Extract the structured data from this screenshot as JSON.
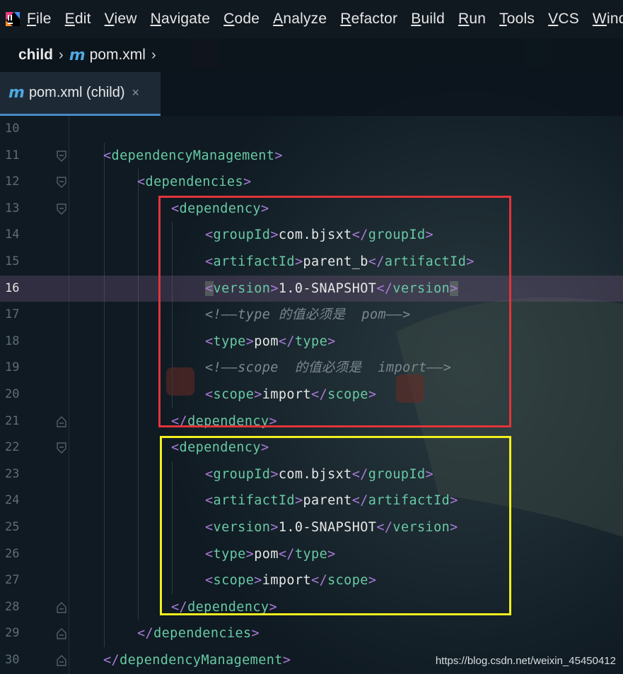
{
  "menu": {
    "items": [
      "File",
      "Edit",
      "View",
      "Navigate",
      "Code",
      "Analyze",
      "Refactor",
      "Build",
      "Run",
      "Tools",
      "VCS",
      "Windo"
    ]
  },
  "breadcrumb": {
    "project": "child",
    "file": "pom.xml"
  },
  "tab": {
    "label": "pom.xml (child)",
    "close": "×",
    "file_icon": "maven-m-icon"
  },
  "editor": {
    "current_line": "16",
    "lines": [
      {
        "num": "10",
        "tokens": []
      },
      {
        "num": "11",
        "tokens": [
          [
            "punct",
            "<"
          ],
          [
            "tag",
            "dependencyManagement"
          ],
          [
            "punct",
            ">"
          ]
        ]
      },
      {
        "num": "12",
        "tokens": [
          [
            "punct",
            "<"
          ],
          [
            "tag",
            "dependencies"
          ],
          [
            "punct",
            ">"
          ]
        ]
      },
      {
        "num": "13",
        "tokens": [
          [
            "punct",
            "<"
          ],
          [
            "tag",
            "dependency"
          ],
          [
            "punct",
            ">"
          ]
        ]
      },
      {
        "num": "14",
        "tokens": [
          [
            "punct",
            "<"
          ],
          [
            "tag",
            "groupId"
          ],
          [
            "punct",
            ">"
          ],
          [
            "text",
            "com.bjsxt"
          ],
          [
            "punct",
            "</"
          ],
          [
            "tag",
            "groupId"
          ],
          [
            "punct",
            ">"
          ]
        ]
      },
      {
        "num": "15",
        "tokens": [
          [
            "punct",
            "<"
          ],
          [
            "tag",
            "artifactId"
          ],
          [
            "punct",
            ">"
          ],
          [
            "text",
            "parent_b"
          ],
          [
            "punct",
            "</"
          ],
          [
            "tag",
            "artifactId"
          ],
          [
            "punct",
            ">"
          ]
        ]
      },
      {
        "num": "16",
        "tokens": [
          [
            "punct",
            "<"
          ],
          [
            "tag",
            "version"
          ],
          [
            "punct",
            ">"
          ],
          [
            "text",
            "1.0-SNAPSHOT"
          ],
          [
            "punct",
            "</"
          ],
          [
            "tag",
            "version"
          ],
          [
            "punct",
            ">"
          ]
        ]
      },
      {
        "num": "17",
        "tokens": [
          [
            "comment",
            "<!——type 的值必须是  pom——>"
          ]
        ]
      },
      {
        "num": "18",
        "tokens": [
          [
            "punct",
            "<"
          ],
          [
            "tag",
            "type"
          ],
          [
            "punct",
            ">"
          ],
          [
            "text",
            "pom"
          ],
          [
            "punct",
            "</"
          ],
          [
            "tag",
            "type"
          ],
          [
            "punct",
            ">"
          ]
        ]
      },
      {
        "num": "19",
        "tokens": [
          [
            "comment",
            "<!——scope  的值必须是  import——>"
          ]
        ]
      },
      {
        "num": "20",
        "tokens": [
          [
            "punct",
            "<"
          ],
          [
            "tag",
            "scope"
          ],
          [
            "punct",
            ">"
          ],
          [
            "text",
            "import"
          ],
          [
            "punct",
            "</"
          ],
          [
            "tag",
            "scope"
          ],
          [
            "punct",
            ">"
          ]
        ]
      },
      {
        "num": "21",
        "tokens": [
          [
            "punct",
            "</"
          ],
          [
            "tag",
            "dependency"
          ],
          [
            "punct",
            ">"
          ]
        ]
      },
      {
        "num": "22",
        "tokens": [
          [
            "punct",
            "<"
          ],
          [
            "tag",
            "dependency"
          ],
          [
            "punct",
            ">"
          ]
        ]
      },
      {
        "num": "23",
        "tokens": [
          [
            "punct",
            "<"
          ],
          [
            "tag",
            "groupId"
          ],
          [
            "punct",
            ">"
          ],
          [
            "text",
            "com.bjsxt"
          ],
          [
            "punct",
            "</"
          ],
          [
            "tag",
            "groupId"
          ],
          [
            "punct",
            ">"
          ]
        ]
      },
      {
        "num": "24",
        "tokens": [
          [
            "punct",
            "<"
          ],
          [
            "tag",
            "artifactId"
          ],
          [
            "punct",
            ">"
          ],
          [
            "text",
            "parent"
          ],
          [
            "punct",
            "</"
          ],
          [
            "tag",
            "artifactId"
          ],
          [
            "punct",
            ">"
          ]
        ]
      },
      {
        "num": "25",
        "tokens": [
          [
            "punct",
            "<"
          ],
          [
            "tag",
            "version"
          ],
          [
            "punct",
            ">"
          ],
          [
            "text",
            "1.0-SNAPSHOT"
          ],
          [
            "punct",
            "</"
          ],
          [
            "tag",
            "version"
          ],
          [
            "punct",
            ">"
          ]
        ]
      },
      {
        "num": "26",
        "tokens": [
          [
            "punct",
            "<"
          ],
          [
            "tag",
            "type"
          ],
          [
            "punct",
            ">"
          ],
          [
            "text",
            "pom"
          ],
          [
            "punct",
            "</"
          ],
          [
            "tag",
            "type"
          ],
          [
            "punct",
            ">"
          ]
        ]
      },
      {
        "num": "27",
        "tokens": [
          [
            "punct",
            "<"
          ],
          [
            "tag",
            "scope"
          ],
          [
            "punct",
            ">"
          ],
          [
            "text",
            "import"
          ],
          [
            "punct",
            "</"
          ],
          [
            "tag",
            "scope"
          ],
          [
            "punct",
            ">"
          ]
        ]
      },
      {
        "num": "28",
        "tokens": [
          [
            "punct",
            "</"
          ],
          [
            "tag",
            "dependency"
          ],
          [
            "punct",
            ">"
          ]
        ]
      },
      {
        "num": "29",
        "tokens": [
          [
            "punct",
            "</"
          ],
          [
            "tag",
            "dependencies"
          ],
          [
            "punct",
            ">"
          ]
        ]
      },
      {
        "num": "30",
        "tokens": [
          [
            "punct",
            "</"
          ],
          [
            "tag",
            "dependencyManagement"
          ],
          [
            "punct",
            ">"
          ]
        ]
      }
    ]
  },
  "colors": {
    "tag": "#68c9a5",
    "bracket": "#a97bd9",
    "text": "#e6e6e6",
    "comment": "#7d8890",
    "red_box": "#e2343a",
    "yellow_box": "#f2ef1d"
  },
  "watermark": "https://blog.csdn.net/weixin_45450412"
}
